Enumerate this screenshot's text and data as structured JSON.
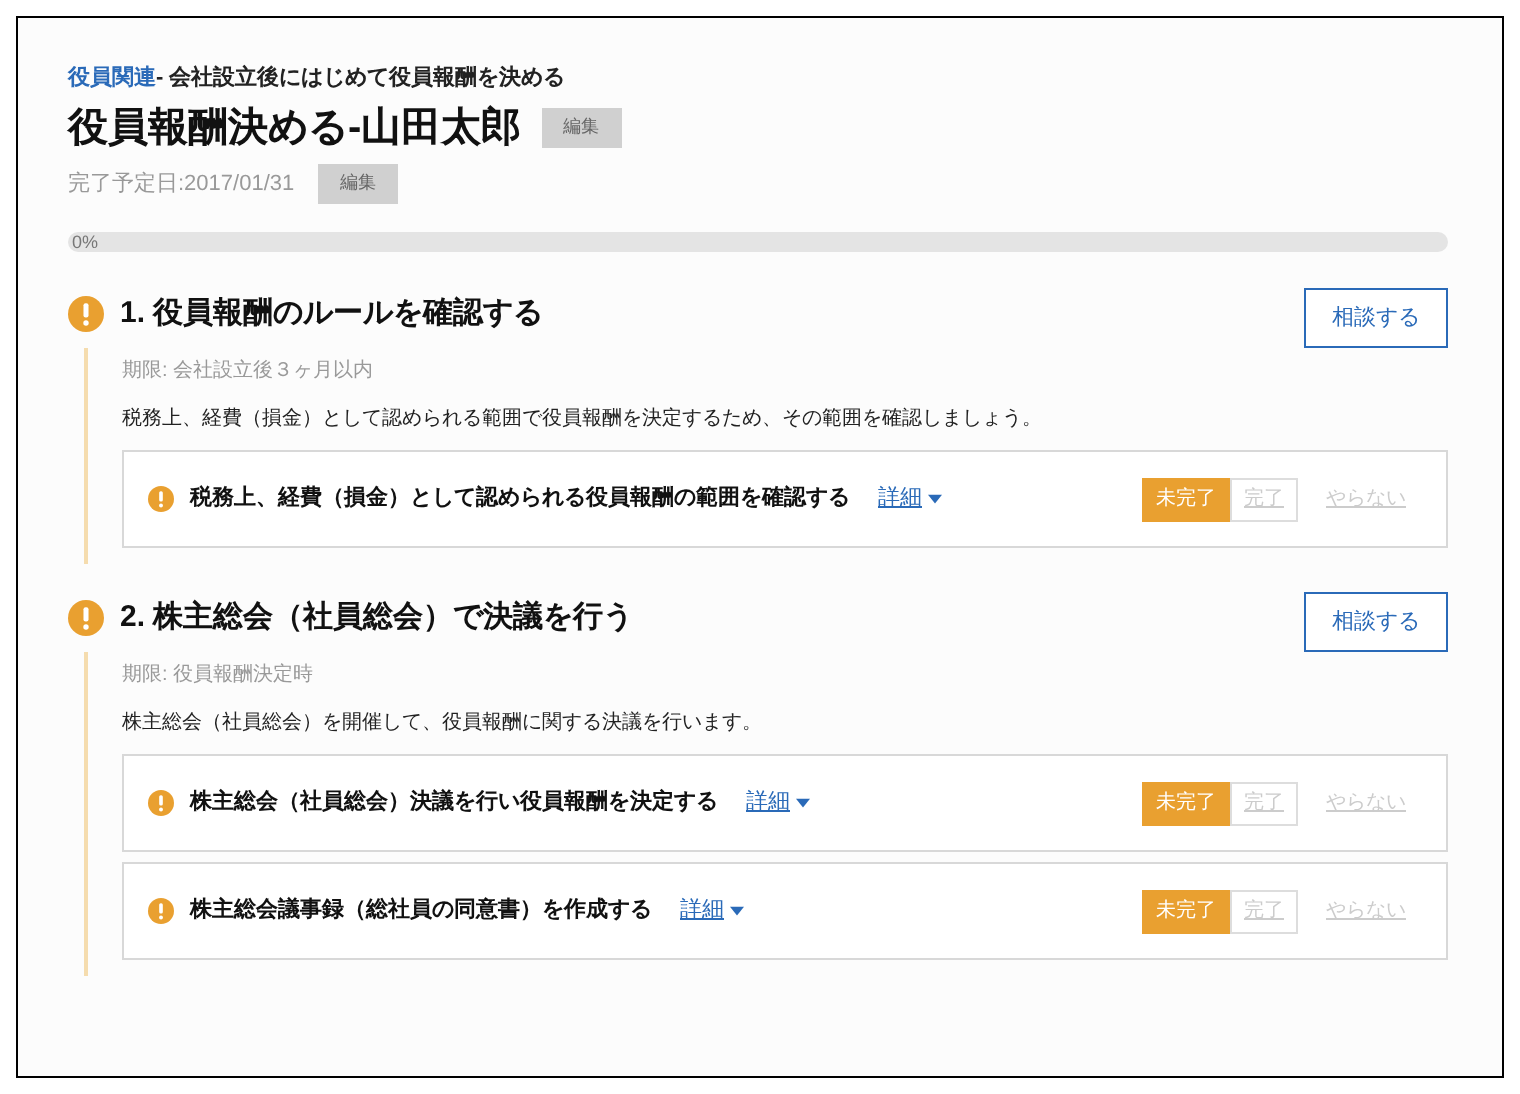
{
  "breadcrumb": {
    "link": "役員関連",
    "text": "- 会社設立後にはじめて役員報酬を決める"
  },
  "title": "役員報酬決める-山田太郎",
  "title_edit": "編集",
  "due": "完了予定日:2017/01/31",
  "due_edit": "編集",
  "progress": {
    "label": "0%",
    "level": 0
  },
  "sections": [
    {
      "title": "1. 役員報酬のルールを確認する",
      "consult": "相談する",
      "deadline": "期限: 会社設立後３ヶ月以内",
      "description": "税務上、経費（損金）として認められる範囲で役員報酬を決定するため、その範囲を確認しましょう。",
      "tasks": [
        {
          "title": "税務上、経費（損金）として認められる役員報酬の範囲を確認する",
          "detail": "詳細",
          "statuses": [
            {
              "label": "未完了",
              "selected": true
            },
            {
              "label": "完了",
              "selected": false
            }
          ],
          "skip": "やらない"
        }
      ]
    },
    {
      "title": "2. 株主総会（社員総会）で決議を行う",
      "consult": "相談する",
      "deadline": "期限: 役員報酬決定時",
      "description": "株主総会（社員総会）を開催して、役員報酬に関する決議を行います。",
      "tasks": [
        {
          "title": "株主総会（社員総会）決議を行い役員報酬を決定する",
          "detail": "詳細",
          "statuses": [
            {
              "label": "未完了",
              "selected": true
            },
            {
              "label": "完了",
              "selected": false
            }
          ],
          "skip": "やらない"
        },
        {
          "title": "株主総会議事録（総社員の同意書）を作成する",
          "detail": "詳細",
          "statuses": [
            {
              "label": "未完了",
              "selected": true
            },
            {
              "label": "完了",
              "selected": false
            }
          ],
          "skip": "やらない"
        }
      ]
    }
  ]
}
